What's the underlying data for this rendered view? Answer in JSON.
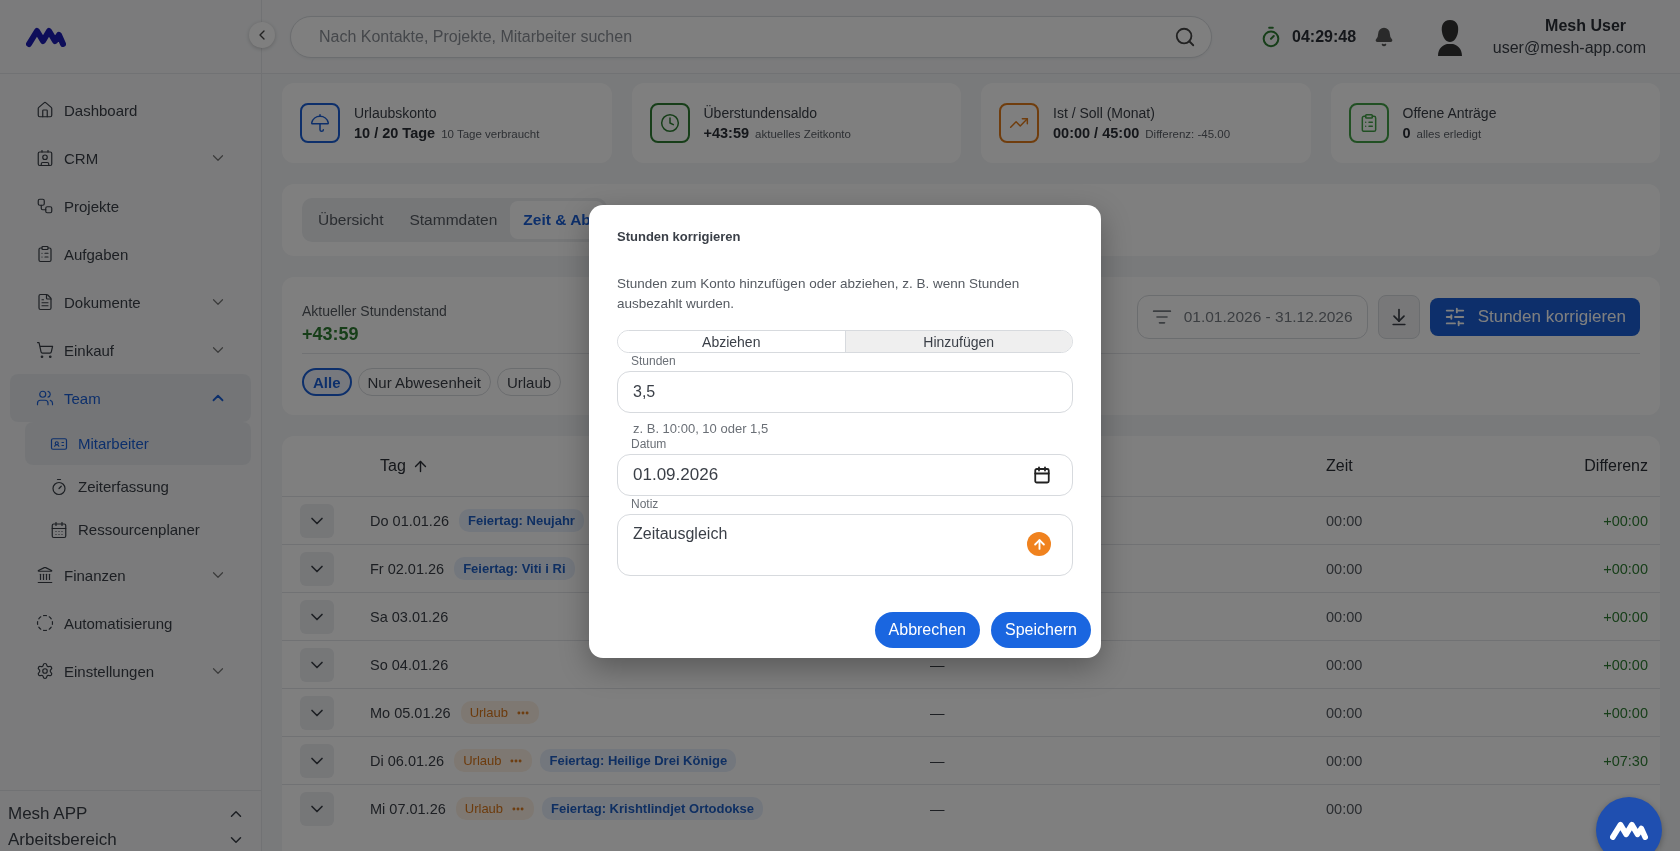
{
  "header": {
    "search": {
      "placeholder": "Nach Kontakte, Projekte, Mitarbeiter suchen"
    },
    "timer": "04:29:48",
    "user": {
      "name": "Mesh User",
      "email": "user@mesh-app.com"
    }
  },
  "nav": [
    {
      "label": "Dashboard",
      "selected": false
    },
    {
      "label": "CRM",
      "expanded": false,
      "selected": false
    },
    {
      "label": "Projekte",
      "selected": false
    },
    {
      "label": "Aufgaben",
      "selected": false
    },
    {
      "label": "Dokumente",
      "expanded": false,
      "selected": false
    },
    {
      "label": "Einkauf",
      "expanded": false,
      "selected": false
    },
    {
      "label": "Team",
      "expanded": true,
      "selected": true,
      "children": [
        {
          "label": "Mitarbeiter",
          "selected": true
        },
        {
          "label": "Zeiterfassung",
          "selected": false
        },
        {
          "label": "Ressourcenplaner",
          "selected": false
        }
      ]
    },
    {
      "label": "Finanzen",
      "expanded": false,
      "selected": false
    },
    {
      "label": "Automatisierung",
      "selected": false
    },
    {
      "label": "Einstellungen",
      "expanded": false,
      "selected": false
    }
  ],
  "workspace": [
    {
      "label": "Mesh APP",
      "expanded": true
    },
    {
      "label": "Arbeitsbereich",
      "expanded": false
    }
  ],
  "stats": [
    {
      "title": "Urlaubskonto",
      "value": "10 / 20 Tage",
      "note": "10 Tage verbraucht"
    },
    {
      "title": "Überstundensaldo",
      "value": "+43:59",
      "note": "aktuelles Zeitkonto"
    },
    {
      "title": "Ist / Soll (Monat)",
      "value": "00:00 / 45:00",
      "note": "Differenz: -45.00"
    },
    {
      "title": "Offene Anträge",
      "value": "0",
      "note": "alles erledigt"
    }
  ],
  "tabs": [
    {
      "label": "Übersicht",
      "selected": false
    },
    {
      "label": "Stammdaten",
      "selected": false
    },
    {
      "label": "Zeit & Ab",
      "selected": true
    }
  ],
  "balance": {
    "label": "Aktueller Stundenstand",
    "value": "+43:59",
    "date_range": "01.01.2026 - 31.12.2026",
    "correct_button": "Stunden korrigieren",
    "filters": [
      {
        "label": "Alle",
        "selected": true
      },
      {
        "label": "Nur Abwesenheit",
        "selected": false
      },
      {
        "label": "Urlaub",
        "selected": false
      }
    ]
  },
  "table": {
    "columns": [
      {
        "label": "Tag",
        "sorted": true
      },
      {
        "label": "Zeit"
      },
      {
        "label": "Differenz"
      }
    ],
    "rows": [
      {
        "day": "Do 01.01.26",
        "tags": [
          {
            "kind": "holiday",
            "label": "Feiertag: Neujahr"
          }
        ],
        "time": "00:00",
        "difference": "+00:00"
      },
      {
        "day": "Fr 02.01.26",
        "tags": [
          {
            "kind": "holiday",
            "label": "Feiertag: Viti i Ri"
          }
        ],
        "time": "00:00",
        "difference": "+00:00"
      },
      {
        "day": "Sa 03.01.26",
        "time": "00:00",
        "difference": "+00:00"
      },
      {
        "day": "So 04.01.26",
        "column_3": "—",
        "time": "00:00",
        "difference": "+00:00"
      },
      {
        "day": "Mo 05.01.26",
        "tags": [
          {
            "kind": "vacation",
            "label": "Urlaub"
          }
        ],
        "column_3": "—",
        "time": "00:00",
        "difference": "+00:00"
      },
      {
        "day": "Di 06.01.26",
        "tags": [
          {
            "kind": "vacation",
            "label": "Urlaub"
          },
          {
            "kind": "holiday",
            "label": "Feiertag: Heilige Drei Könige"
          }
        ],
        "column_3": "—",
        "time": "00:00",
        "difference": "+07:30"
      },
      {
        "day": "Mi 07.01.26",
        "tags": [
          {
            "kind": "vacation",
            "label": "Urlaub"
          },
          {
            "kind": "holiday",
            "label": "Feiertag: Krishtlindjet Ortodokse"
          }
        ],
        "column_3": "—",
        "time": "00:00"
      }
    ]
  },
  "dialog": {
    "title": "Stunden korrigieren",
    "description": "Stunden zum Konto hinzufügen oder abziehen, z. B. wenn Stunden ausbezahlt wurden.",
    "modes": [
      {
        "label": "Abziehen",
        "selected": false
      },
      {
        "label": "Hinzufügen",
        "selected": true
      }
    ],
    "hours": {
      "label": "Stunden",
      "value": "3,5",
      "hint": "z. B. 10:00, 10 oder 1,5"
    },
    "date": {
      "label": "Datum",
      "value": "01.09.2026"
    },
    "note": {
      "label": "Notiz",
      "value": "Zeitausgleich"
    },
    "buttons": [
      "Abbrechen",
      "Speichern"
    ]
  }
}
